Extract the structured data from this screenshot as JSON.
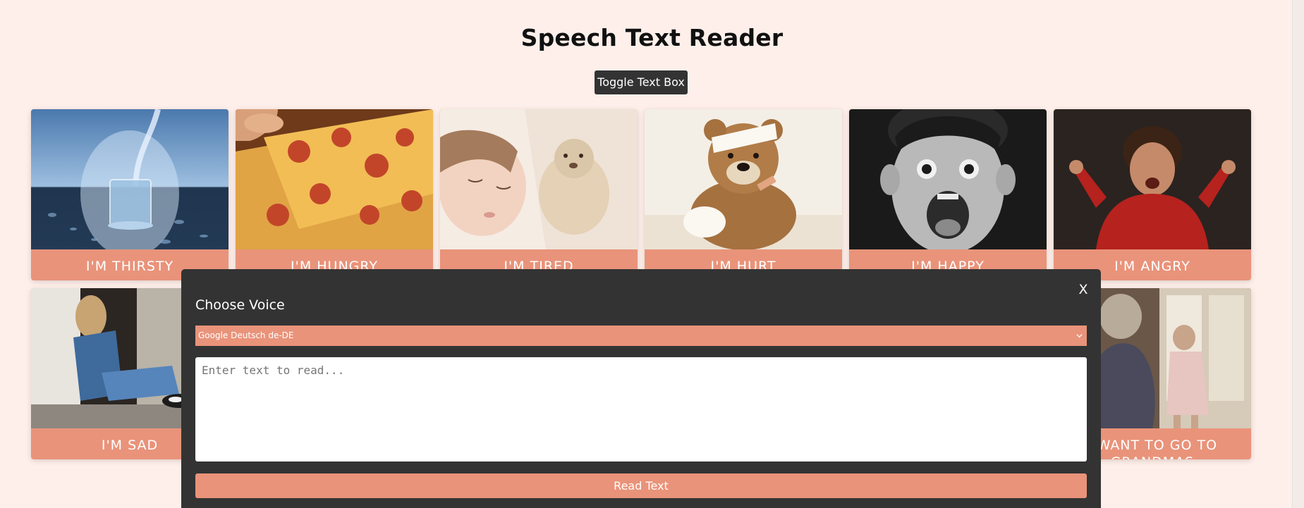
{
  "page": {
    "title": "Speech Text Reader",
    "toggle_label": "Toggle Text Box"
  },
  "cards": [
    {
      "label": "I'm Thirsty",
      "image": "glass-of-water"
    },
    {
      "label": "I'm Hungry",
      "image": "pizza-slice"
    },
    {
      "label": "I'm Tired",
      "image": "sleeping-child"
    },
    {
      "label": "I'm Hurt",
      "image": "bandaged-teddy-bear"
    },
    {
      "label": "I'm Happy",
      "image": "excited-boy"
    },
    {
      "label": "I'm Angry",
      "image": "angry-child"
    },
    {
      "label": "I'm Sad",
      "image": "sad-girl"
    },
    {
      "label": "I Want To Go To Grandmas",
      "image": "grandmother-and-child"
    }
  ],
  "modal": {
    "close_label": "X",
    "title": "Choose Voice",
    "voice_selected": "Google Deutsch de-DE",
    "text_placeholder": "Enter text to read...",
    "read_label": "Read Text"
  },
  "colors": {
    "background": "#ffefea",
    "accent": "#e9937a",
    "dark": "#333333"
  }
}
